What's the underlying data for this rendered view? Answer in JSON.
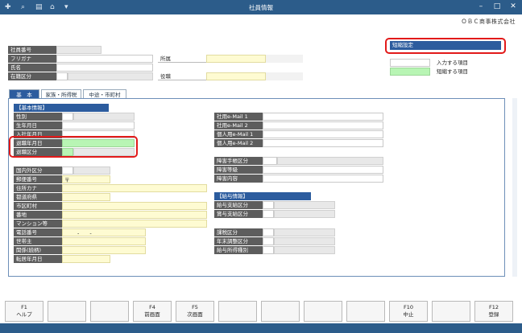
{
  "window": {
    "title": "社員情報"
  },
  "company": "ＯＢＣ商事株式会社",
  "header": {
    "employee_number": "社員番号",
    "furigana": "フリガナ",
    "name": "氏名",
    "employment_status": "在籍区分",
    "department": "所属",
    "position": "役職"
  },
  "short_setting": {
    "button": "短縮設定",
    "legend_input": "入力する項目",
    "legend_short": "短縮する項目"
  },
  "tabs": [
    {
      "label": "基　本"
    },
    {
      "label": "家族・所得税"
    },
    {
      "label": "中途・市町村"
    }
  ],
  "basic": {
    "section": "【基本情報】",
    "gender": "性別",
    "birthdate": "生年月日",
    "hire_date": "入社年月日",
    "retire_date": "退職年月日",
    "retire_category": "退職区分",
    "domestic_foreign": "国内外区分",
    "postal_code": "郵便番号",
    "postal_mark": "〒",
    "address_kana": "住所カナ",
    "prefecture": "都道府県",
    "city": "市区町村",
    "street_number": "番地",
    "building": "マンション等",
    "phone": "電話番号",
    "phone_value": "-　　-",
    "householder": "世帯主",
    "relation": "関係(続柄)",
    "moving_date": "転居年月日"
  },
  "right": {
    "company_mail1": "社用e-Mail 1",
    "company_mail2": "社用e-Mail 2",
    "personal_mail1": "個人用e-Mail 1",
    "personal_mail2": "個人用e-Mail 2",
    "disability_cert": "障害手帳区分",
    "disability_level": "障害等級",
    "disability_detail": "障害内容",
    "salary_section": "【給与情報】",
    "salary_pay": "給与支給区分",
    "bonus_pay": "賞与支給区分",
    "tax_category": "課税区分",
    "year_end": "年末調整区分",
    "salary_income_type": "給与所得種別"
  },
  "fkeys": [
    {
      "key": "F1",
      "label": "ヘルプ"
    },
    {
      "key": "",
      "label": ""
    },
    {
      "key": "",
      "label": ""
    },
    {
      "key": "F4",
      "label": "前画面"
    },
    {
      "key": "F5",
      "label": "次画面"
    },
    {
      "key": "",
      "label": ""
    },
    {
      "key": "",
      "label": ""
    },
    {
      "key": "",
      "label": ""
    },
    {
      "key": "",
      "label": ""
    },
    {
      "key": "F10",
      "label": "中止"
    },
    {
      "key": "",
      "label": ""
    },
    {
      "key": "F12",
      "label": "登録"
    }
  ],
  "colors": {
    "title": "#2c5c8a",
    "accent": "#2c5c9e",
    "highlight_red": "#e21a1a",
    "yellow": "#fefbd2",
    "green": "#b8f5b4"
  }
}
